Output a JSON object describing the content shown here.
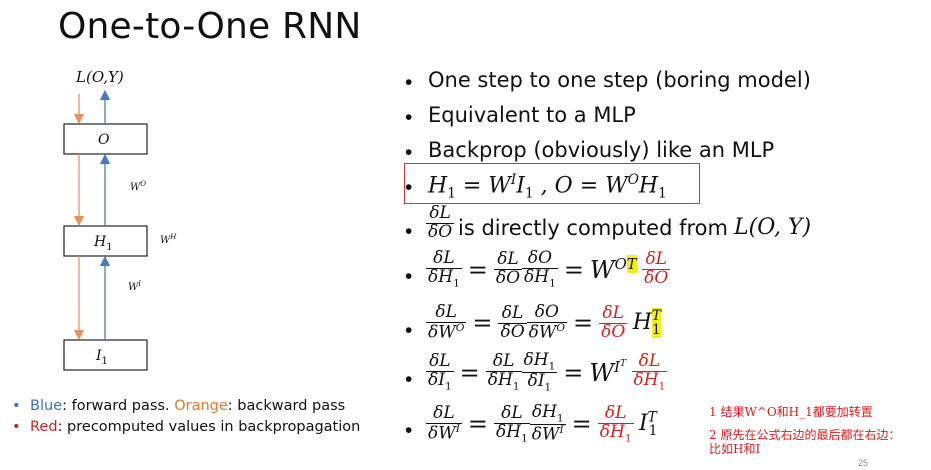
{
  "slide": {
    "title": "One-to-One RNN",
    "page_number": "25"
  },
  "diagram": {
    "loss_label": "L(O,Y)",
    "nodes": [
      "O",
      "H",
      "I"
    ],
    "node_sub": "1",
    "weights": {
      "wo": "W",
      "wo_sup": "O",
      "wh": "W",
      "wh_sup": "H",
      "wi": "W",
      "wi_sup": "I"
    },
    "colors": {
      "forward": "#4a7ac4",
      "backward": "#e8925a"
    }
  },
  "legend": {
    "blue_word": "Blue",
    "blue_rest": ": forward pass. ",
    "orange_word": "Orange",
    "orange_rest": ": backward pass",
    "red_word": "Red",
    "red_rest": ": precomputed values in backpropagation"
  },
  "bullets": {
    "b1": "One step to one step (boring model)",
    "b2": "Equivalent to a MLP",
    "b3": "Backprop (obviously) like an MLP",
    "b5_text": "is directly computed from"
  },
  "annotations": {
    "note1": "1 结果W^O和H_1都要加转置",
    "note2_line1": "2 原先在公式右边的最后都在右边：",
    "note2_line2": "比如H和I"
  }
}
